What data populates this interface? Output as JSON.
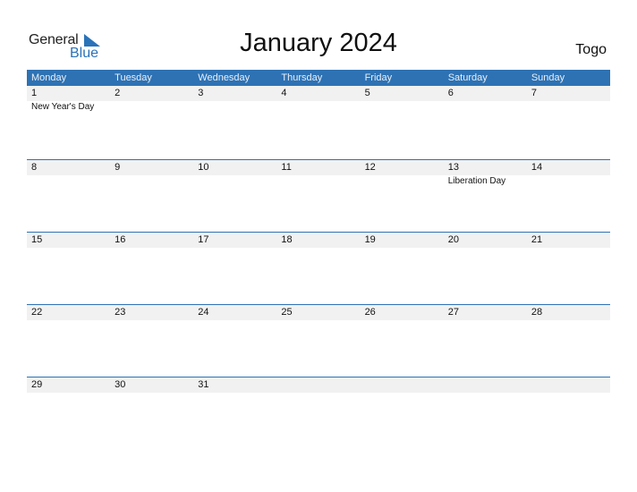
{
  "logo": {
    "part1": "General",
    "part2": "Blue"
  },
  "header": {
    "title": "January 2024",
    "country": "Togo"
  },
  "colors": {
    "accent": "#2e72b4",
    "day_strip": "#f1f1f1",
    "logo_blue": "#2a73b9"
  },
  "weekdays": [
    "Monday",
    "Tuesday",
    "Wednesday",
    "Thursday",
    "Friday",
    "Saturday",
    "Sunday"
  ],
  "weeks": [
    {
      "days": [
        "1",
        "2",
        "3",
        "4",
        "5",
        "6",
        "7"
      ],
      "events": [
        "New Year's Day",
        "",
        "",
        "",
        "",
        "",
        ""
      ]
    },
    {
      "days": [
        "8",
        "9",
        "10",
        "11",
        "12",
        "13",
        "14"
      ],
      "events": [
        "",
        "",
        "",
        "",
        "",
        "Liberation Day",
        ""
      ]
    },
    {
      "days": [
        "15",
        "16",
        "17",
        "18",
        "19",
        "20",
        "21"
      ],
      "events": [
        "",
        "",
        "",
        "",
        "",
        "",
        ""
      ]
    },
    {
      "days": [
        "22",
        "23",
        "24",
        "25",
        "26",
        "27",
        "28"
      ],
      "events": [
        "",
        "",
        "",
        "",
        "",
        "",
        ""
      ]
    },
    {
      "days": [
        "29",
        "30",
        "31",
        "",
        "",
        "",
        ""
      ],
      "events": [
        "",
        "",
        "",
        "",
        "",
        "",
        ""
      ]
    }
  ]
}
